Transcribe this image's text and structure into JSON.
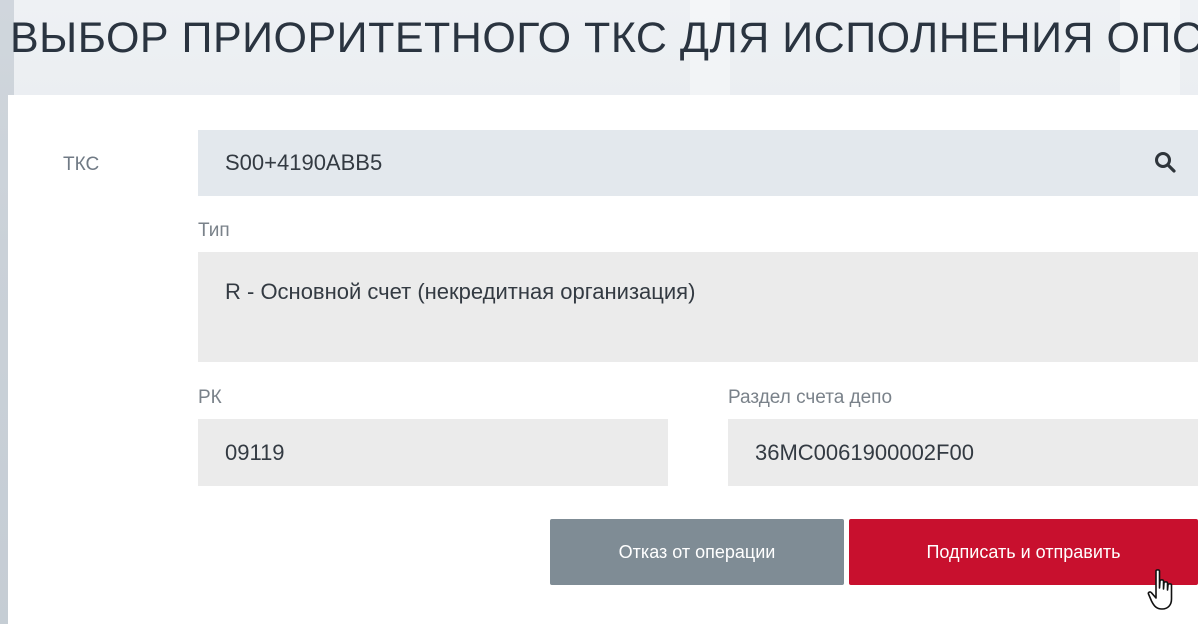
{
  "page": {
    "title": "ВЫБОР ПРИОРИТЕТНОГО ТКС ДЛЯ ИСПОЛНЕНИЯ ОПС"
  },
  "form": {
    "tks": {
      "label": "ТКС",
      "value": "S00+4190ABB5",
      "icon": "search-icon"
    },
    "type": {
      "label": "Тип",
      "value": "R - Основной счет (некредитная организация)"
    },
    "rk": {
      "label": "РК",
      "value": "09119"
    },
    "depo_section": {
      "label": "Раздел счета депо",
      "value": "36MC0061900002F00"
    }
  },
  "actions": {
    "cancel_label": "Отказ от операции",
    "sign_label": "Подписать и отправить"
  },
  "colors": {
    "accent": "#c8102e",
    "secondary_button": "#7f8c95",
    "input_bg": "#e3e8ed",
    "readonly_bg": "#ebebeb",
    "title": "#2a3440"
  },
  "cursor": "hand-pointer-icon"
}
